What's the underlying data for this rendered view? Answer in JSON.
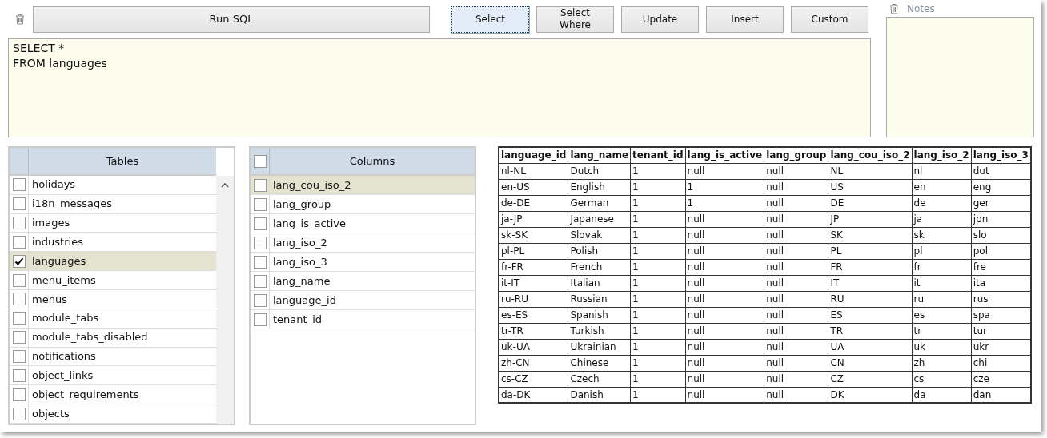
{
  "toolbar": {
    "run_button": "Run SQL",
    "query_buttons": [
      {
        "label": "Select",
        "selected": true
      },
      {
        "label": "Select Where",
        "selected": false
      },
      {
        "label": "Update",
        "selected": false
      },
      {
        "label": "Insert",
        "selected": false
      },
      {
        "label": "Custom",
        "selected": false
      }
    ]
  },
  "notes": {
    "label": "Notes"
  },
  "sql_editor": {
    "lines": [
      "SELECT *",
      "FROM languages"
    ]
  },
  "tables_panel": {
    "header": "Tables",
    "items": [
      {
        "name": "holidays",
        "checked": false,
        "selected": false
      },
      {
        "name": "i18n_messages",
        "checked": false,
        "selected": false
      },
      {
        "name": "images",
        "checked": false,
        "selected": false
      },
      {
        "name": "industries",
        "checked": false,
        "selected": false
      },
      {
        "name": "languages",
        "checked": true,
        "selected": true
      },
      {
        "name": "menu_items",
        "checked": false,
        "selected": false
      },
      {
        "name": "menus",
        "checked": false,
        "selected": false
      },
      {
        "name": "module_tabs",
        "checked": false,
        "selected": false
      },
      {
        "name": "module_tabs_disabled",
        "checked": false,
        "selected": false
      },
      {
        "name": "notifications",
        "checked": false,
        "selected": false
      },
      {
        "name": "object_links",
        "checked": false,
        "selected": false
      },
      {
        "name": "object_requirements",
        "checked": false,
        "selected": false
      },
      {
        "name": "objects",
        "checked": false,
        "selected": false
      }
    ]
  },
  "columns_panel": {
    "header": "Columns",
    "all_checked": false,
    "items": [
      {
        "name": "lang_cou_iso_2",
        "checked": false,
        "selected": true
      },
      {
        "name": "lang_group",
        "checked": false,
        "selected": false
      },
      {
        "name": "lang_is_active",
        "checked": false,
        "selected": false
      },
      {
        "name": "lang_iso_2",
        "checked": false,
        "selected": false
      },
      {
        "name": "lang_iso_3",
        "checked": false,
        "selected": false
      },
      {
        "name": "lang_name",
        "checked": false,
        "selected": false
      },
      {
        "name": "language_id",
        "checked": false,
        "selected": false
      },
      {
        "name": "tenant_id",
        "checked": false,
        "selected": false
      }
    ]
  },
  "results": {
    "columns": [
      "language_id",
      "lang_name",
      "tenant_id",
      "lang_is_active",
      "lang_group",
      "lang_cou_iso_2",
      "lang_iso_2",
      "lang_iso_3"
    ],
    "rows": [
      [
        "nl-NL",
        "Dutch",
        "1",
        "null",
        "null",
        "NL",
        "nl",
        "dut"
      ],
      [
        "en-US",
        "English",
        "1",
        "1",
        "null",
        "US",
        "en",
        "eng"
      ],
      [
        "de-DE",
        "German",
        "1",
        "1",
        "null",
        "DE",
        "de",
        "ger"
      ],
      [
        "ja-JP",
        "Japanese",
        "1",
        "null",
        "null",
        "JP",
        "ja",
        "jpn"
      ],
      [
        "sk-SK",
        "Slovak",
        "1",
        "null",
        "null",
        "SK",
        "sk",
        "slo"
      ],
      [
        "pl-PL",
        "Polish",
        "1",
        "null",
        "null",
        "PL",
        "pl",
        "pol"
      ],
      [
        "fr-FR",
        "French",
        "1",
        "null",
        "null",
        "FR",
        "fr",
        "fre"
      ],
      [
        "it-IT",
        "Italian",
        "1",
        "null",
        "null",
        "IT",
        "it",
        "ita"
      ],
      [
        "ru-RU",
        "Russian",
        "1",
        "null",
        "null",
        "RU",
        "ru",
        "rus"
      ],
      [
        "es-ES",
        "Spanish",
        "1",
        "null",
        "null",
        "ES",
        "es",
        "spa"
      ],
      [
        "tr-TR",
        "Turkish",
        "1",
        "null",
        "null",
        "TR",
        "tr",
        "tur"
      ],
      [
        "uk-UA",
        "Ukrainian",
        "1",
        "null",
        "null",
        "UA",
        "uk",
        "ukr"
      ],
      [
        "zh-CN",
        "Chinese",
        "1",
        "null",
        "null",
        "CN",
        "zh",
        "chi"
      ],
      [
        "cs-CZ",
        "Czech",
        "1",
        "null",
        "null",
        "CZ",
        "cs",
        "cze"
      ],
      [
        "da-DK",
        "Danish",
        "1",
        "null",
        "null",
        "DK",
        "da",
        "dan"
      ]
    ]
  }
}
